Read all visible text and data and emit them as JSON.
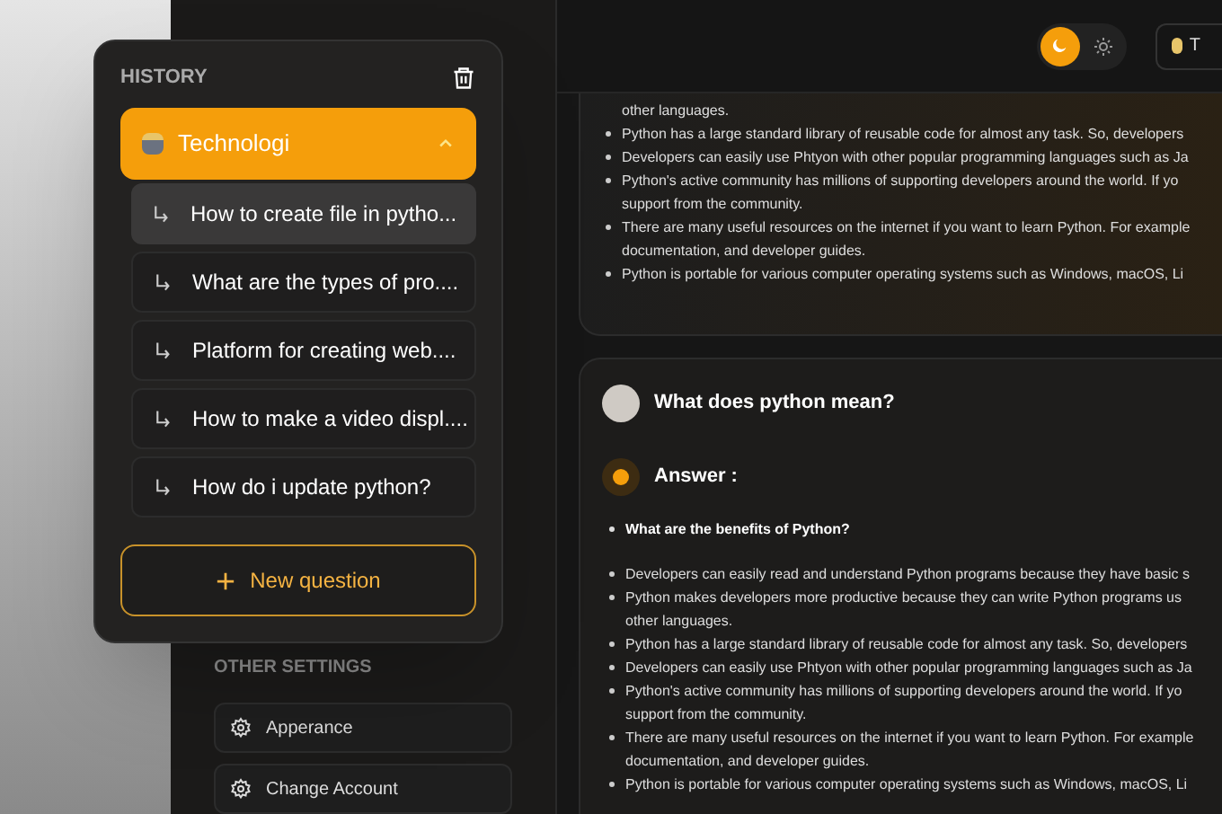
{
  "history": {
    "title": "HISTORY",
    "groups": [
      {
        "label": "Technologi",
        "selected": true,
        "expanded": true,
        "children": [
          {
            "label": "How to create file in pytho...",
            "selected": true
          },
          {
            "label": "What are the types of pro....",
            "selected": false
          },
          {
            "label": "Platform for creating web....",
            "selected": false
          },
          {
            "label": "How to make a video displ....",
            "selected": false
          },
          {
            "label": "How do i update python?",
            "selected": false
          }
        ]
      }
    ],
    "new_question": "New question"
  },
  "other_settings": {
    "title": "OTHER SETTINGS",
    "items": [
      "Apperance",
      "Change Account"
    ]
  },
  "theme_toggle": [
    {
      "kind": "dark",
      "selected": true
    },
    {
      "kind": "light",
      "selected": false
    }
  ],
  "header_button": "T",
  "cards": [
    {
      "lines": [
        {
          "kind": "continuation",
          "text": "other languages."
        },
        {
          "kind": "bullet",
          "text": "Python has a large standard library of reusable code for almost any task. So, developers"
        },
        {
          "kind": "bullet",
          "text": "Developers can easily use Phtyon with other popular programming languages such as Ja"
        },
        {
          "kind": "bullet",
          "text": "Python's active community has millions of supporting developers around the world. If yo"
        },
        {
          "kind": "continuation",
          "text": "support from the community."
        },
        {
          "kind": "bullet",
          "text": "There are many useful resources on the internet if you want to learn Python. For example"
        },
        {
          "kind": "continuation",
          "text": "documentation, and developer guides."
        },
        {
          "kind": "bullet",
          "text": "Python is portable for various computer operating systems such as Windows, macOS, Li"
        }
      ]
    },
    {
      "question": "What does python mean?",
      "answer_label": "Answer :",
      "lines": [
        {
          "kind": "heading",
          "text": "What are the benefits of Python?"
        },
        {
          "kind": "bullet",
          "text": "Developers can easily read and understand Python programs because they have basic s"
        },
        {
          "kind": "bullet",
          "text": "Python makes developers more productive because they can write Python programs us"
        },
        {
          "kind": "continuation",
          "text": "other languages."
        },
        {
          "kind": "bullet",
          "text": "Python has a large standard library of reusable code for almost any task. So, developers"
        },
        {
          "kind": "bullet",
          "text": "Developers can easily use Phtyon with other popular programming languages such as Ja"
        },
        {
          "kind": "bullet",
          "text": "Python's active community has millions of supporting developers around the world. If yo"
        },
        {
          "kind": "continuation",
          "text": "support from the community."
        },
        {
          "kind": "bullet",
          "text": "There are many useful resources on the internet if you want to learn Python. For example"
        },
        {
          "kind": "continuation",
          "text": "documentation, and developer guides."
        },
        {
          "kind": "bullet",
          "text": "Python is portable for various computer operating systems such as Windows, macOS, Li"
        }
      ]
    }
  ]
}
